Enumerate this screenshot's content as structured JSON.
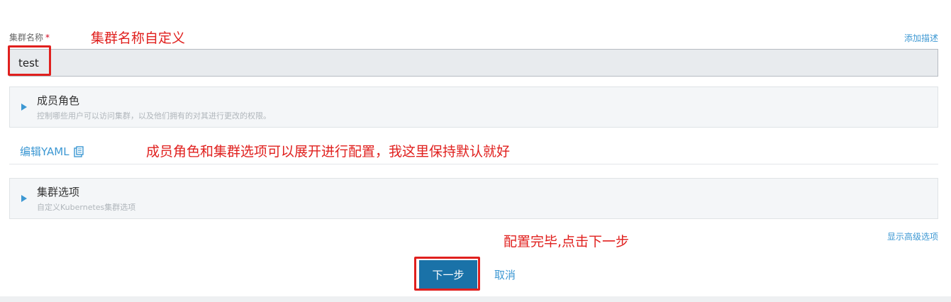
{
  "form": {
    "cluster_name_label": "集群名称",
    "required_mark": "*",
    "add_description": "添加描述",
    "cluster_name_value": "test"
  },
  "panels": {
    "member_roles": {
      "title": "成员角色",
      "description": "控制哪些用户可以访问集群，以及他们拥有的对其进行更改的权限。"
    },
    "cluster_options": {
      "title": "集群选项",
      "description": "自定义Kubernetes集群选项"
    }
  },
  "edit_yaml": {
    "label": "编辑YAML"
  },
  "show_advanced": "显示高级选项",
  "actions": {
    "next": "下一步",
    "cancel": "取消"
  },
  "annotations": {
    "name_note": "集群名称自定义",
    "panel_note": "成员角色和集群选项可以展开进行配置，我这里保持默认就好",
    "next_note": "配置完毕,点击下一步"
  },
  "colors": {
    "accent": "#3d98d3",
    "primary_button": "#1a72a8",
    "annotation_red": "#e0201e"
  }
}
